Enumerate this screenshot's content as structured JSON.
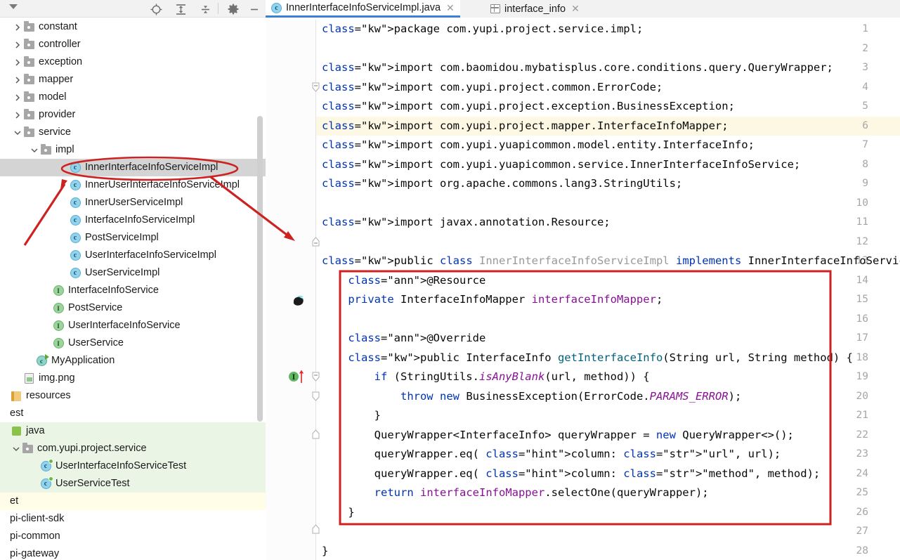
{
  "app": {
    "kind": "java-ide",
    "accent": "#3b80d4"
  },
  "sidebar": {
    "toolbar": {
      "menu_arrow": "panel-options",
      "icons": [
        "locate-target-icon",
        "expand-all-icon",
        "collapse-all-icon",
        "settings-gear-icon",
        "minimize-icon"
      ]
    },
    "items": [
      {
        "label": "constant",
        "indent": 18,
        "arrow": "right",
        "icon": "folder",
        "state": "normal"
      },
      {
        "label": "controller",
        "indent": 18,
        "arrow": "right",
        "icon": "folder",
        "state": "normal"
      },
      {
        "label": "exception",
        "indent": 18,
        "arrow": "right",
        "icon": "folder",
        "state": "normal"
      },
      {
        "label": "mapper",
        "indent": 18,
        "arrow": "right",
        "icon": "folder",
        "state": "normal"
      },
      {
        "label": "model",
        "indent": 18,
        "arrow": "right",
        "icon": "folder",
        "state": "normal"
      },
      {
        "label": "provider",
        "indent": 18,
        "arrow": "right",
        "icon": "folder",
        "state": "normal"
      },
      {
        "label": "service",
        "indent": 18,
        "arrow": "down",
        "icon": "folder",
        "state": "normal"
      },
      {
        "label": "impl",
        "indent": 42,
        "arrow": "down",
        "icon": "folder",
        "state": "normal"
      },
      {
        "label": "InnerInterfaceInfoServiceImpl",
        "indent": 84,
        "arrow": "none",
        "icon": "class",
        "state": "selected"
      },
      {
        "label": "InnerUserInterfaceInfoServiceImpl",
        "indent": 84,
        "arrow": "none",
        "icon": "class",
        "state": "normal"
      },
      {
        "label": "InnerUserServiceImpl",
        "indent": 84,
        "arrow": "none",
        "icon": "class",
        "state": "normal"
      },
      {
        "label": "InterfaceInfoServiceImpl",
        "indent": 84,
        "arrow": "none",
        "icon": "class",
        "state": "normal"
      },
      {
        "label": "PostServiceImpl",
        "indent": 84,
        "arrow": "none",
        "icon": "class",
        "state": "normal"
      },
      {
        "label": "UserInterfaceInfoServiceImpl",
        "indent": 84,
        "arrow": "none",
        "icon": "class",
        "state": "normal"
      },
      {
        "label": "UserServiceImpl",
        "indent": 84,
        "arrow": "none",
        "icon": "class",
        "state": "normal"
      },
      {
        "label": "InterfaceInfoService",
        "indent": 60,
        "arrow": "none",
        "icon": "interface",
        "state": "normal"
      },
      {
        "label": "PostService",
        "indent": 60,
        "arrow": "none",
        "icon": "interface",
        "state": "normal"
      },
      {
        "label": "UserInterfaceInfoService",
        "indent": 60,
        "arrow": "none",
        "icon": "interface",
        "state": "normal"
      },
      {
        "label": "UserService",
        "indent": 60,
        "arrow": "none",
        "icon": "interface",
        "state": "normal"
      },
      {
        "label": "MyApplication",
        "indent": 36,
        "arrow": "none",
        "icon": "spring-app",
        "state": "normal"
      },
      {
        "label": "img.png",
        "indent": 18,
        "arrow": "none",
        "icon": "png-file",
        "state": "normal"
      },
      {
        "label": "resources",
        "indent": 0,
        "arrow": "none",
        "icon": "resources",
        "state": "normal"
      },
      {
        "label": "est",
        "indent": -10,
        "arrow": "none",
        "icon": "none",
        "state": "normal"
      },
      {
        "label": "java",
        "indent": -10,
        "arrow": "none",
        "icon": "source-root",
        "state": "green"
      },
      {
        "label": "com.yupi.project.service",
        "indent": 16,
        "arrow": "down",
        "icon": "folder",
        "state": "green"
      },
      {
        "label": "UserInterfaceInfoServiceTest",
        "indent": 42,
        "arrow": "none",
        "icon": "test-class",
        "state": "green"
      },
      {
        "label": "UserServiceTest",
        "indent": 42,
        "arrow": "none",
        "icon": "test-class",
        "state": "green"
      },
      {
        "label": "et",
        "indent": -10,
        "arrow": "none",
        "icon": "none",
        "state": "yellow"
      },
      {
        "label": "pi-client-sdk",
        "indent": -10,
        "arrow": "none",
        "icon": "none",
        "state": "normal"
      },
      {
        "label": "pi-common",
        "indent": -10,
        "arrow": "none",
        "icon": "none",
        "state": "normal"
      },
      {
        "label": "pi-gateway",
        "indent": -10,
        "arrow": "none",
        "icon": "none",
        "state": "normal"
      }
    ]
  },
  "tabs": [
    {
      "label": "InnerInterfaceInfoServiceImpl.java",
      "icon": "java-class-icon",
      "active": true,
      "close": "✕"
    },
    {
      "label": "interface_info",
      "icon": "database-table-icon",
      "active": false,
      "close": "✕"
    }
  ],
  "editor": {
    "file": "InnerInterfaceInfoServiceImpl.java",
    "highlighted_line": 6,
    "gutter_markers": [
      {
        "line": 15,
        "icon": "spring-bean-icon"
      },
      {
        "line": 18,
        "icon": "implementing-method-icon"
      }
    ],
    "fold_markers": [
      3,
      11,
      13,
      18,
      19,
      21,
      26
    ],
    "lines": [
      {
        "n": 1,
        "text": "package com.yupi.project.service.impl;"
      },
      {
        "n": 2,
        "text": ""
      },
      {
        "n": 3,
        "text": "import com.baomidou.mybatisplus.core.conditions.query.QueryWrapper;"
      },
      {
        "n": 4,
        "text": "import com.yupi.project.common.ErrorCode;"
      },
      {
        "n": 5,
        "text": "import com.yupi.project.exception.BusinessException;"
      },
      {
        "n": 6,
        "text": "import com.yupi.project.mapper.InterfaceInfoMapper;"
      },
      {
        "n": 7,
        "text": "import com.yupi.yuapicommon.model.entity.InterfaceInfo;"
      },
      {
        "n": 8,
        "text": "import com.yupi.yuapicommon.service.InnerInterfaceInfoService;"
      },
      {
        "n": 9,
        "text": "import org.apache.commons.lang3.StringUtils;"
      },
      {
        "n": 10,
        "text": ""
      },
      {
        "n": 11,
        "text": "import javax.annotation.Resource;"
      },
      {
        "n": 12,
        "text": ""
      },
      {
        "n": 13,
        "text": "public class InnerInterfaceInfoServiceImpl implements InnerInterfaceInfoService {"
      },
      {
        "n": 14,
        "text": "    @Resource"
      },
      {
        "n": 15,
        "text": "    private InterfaceInfoMapper interfaceInfoMapper;"
      },
      {
        "n": 16,
        "text": ""
      },
      {
        "n": 17,
        "text": "    @Override"
      },
      {
        "n": 18,
        "text": "    public InterfaceInfo getInterfaceInfo(String url, String method) {"
      },
      {
        "n": 19,
        "text": "        if (StringUtils.isAnyBlank(url, method)) {"
      },
      {
        "n": 20,
        "text": "            throw new BusinessException(ErrorCode.PARAMS_ERROR);"
      },
      {
        "n": 21,
        "text": "        }"
      },
      {
        "n": 22,
        "text": "        QueryWrapper<InterfaceInfo> queryWrapper = new QueryWrapper<>();"
      },
      {
        "n": 23,
        "text": "        queryWrapper.eq( column: \"url\", url);"
      },
      {
        "n": 24,
        "text": "        queryWrapper.eq( column: \"method\", method);"
      },
      {
        "n": 25,
        "text": "        return interfaceInfoMapper.selectOne(queryWrapper);"
      },
      {
        "n": 26,
        "text": "    }"
      },
      {
        "n": 27,
        "text": ""
      },
      {
        "n": 28,
        "text": "}"
      }
    ]
  },
  "annotations": {
    "color": "#cc2222",
    "shapes": [
      {
        "kind": "ellipse",
        "target": "InnerInterfaceInfoServiceImpl tree item"
      },
      {
        "kind": "arrow",
        "target": "points up-right to InnerInterfaceInfoServiceImpl"
      },
      {
        "kind": "arrow",
        "target": "points down-right from ellipse toward code"
      },
      {
        "kind": "rectangle",
        "target": "class body lines 14-26"
      }
    ]
  }
}
